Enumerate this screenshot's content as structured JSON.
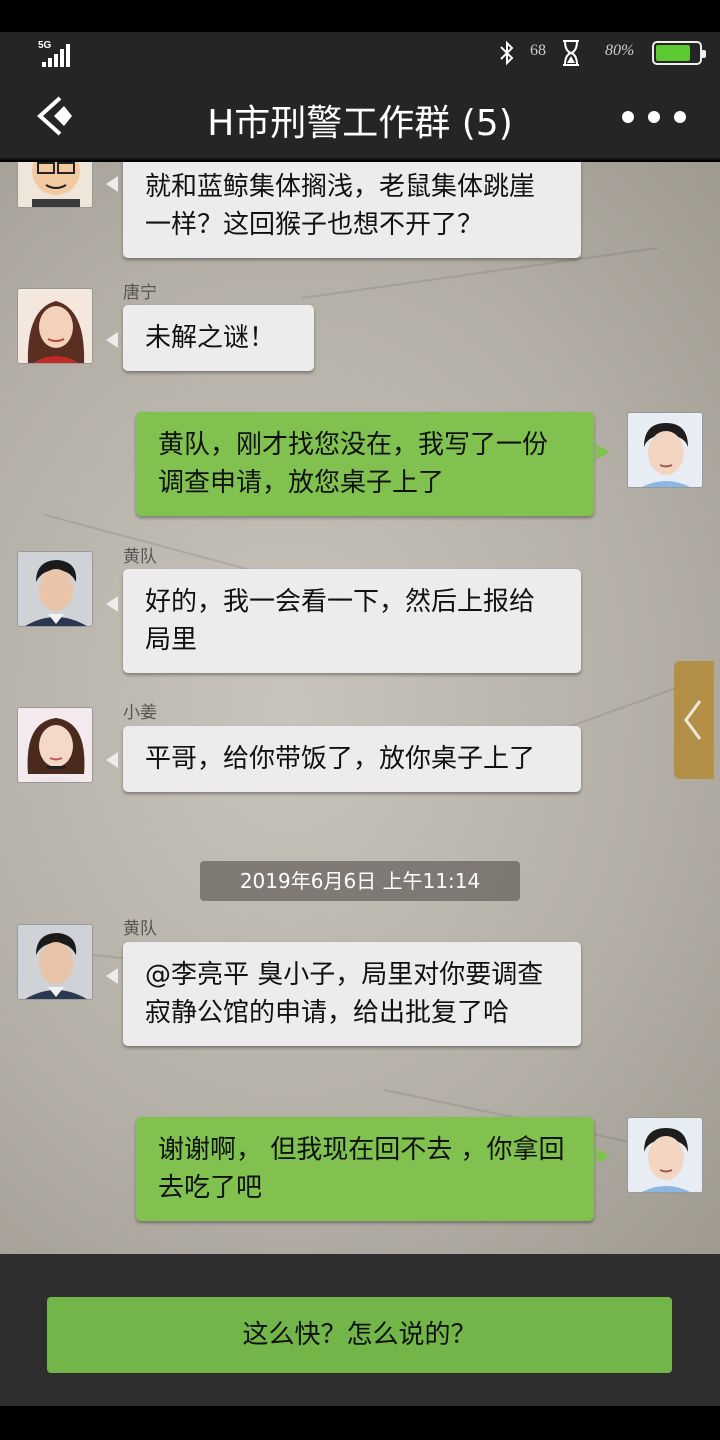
{
  "status_bar": {
    "network": "5G",
    "net_speed": "68",
    "battery_text": "80%",
    "battery_level": 0.8,
    "icons": [
      "signal-icon",
      "bluetooth-icon",
      "hourglass-icon",
      "battery-icon"
    ]
  },
  "header": {
    "title": "H市刑警工作群 (5)",
    "back_icon": "back-chevron-icon",
    "more_icon": "more-dots-icon"
  },
  "messages": [
    {
      "side": "left",
      "sender": "",
      "text": "就和蓝鲸集体搁浅，老鼠集体跳崖一样？这回猴子也想不开了？"
    },
    {
      "side": "left",
      "sender": "唐宁",
      "text": "未解之谜！"
    },
    {
      "side": "right",
      "sender": "",
      "text": "黄队，刚才找您没在，我写了一份调查申请，放您桌子上了"
    },
    {
      "side": "left",
      "sender": "黄队",
      "text": "好的，我一会看一下，然后上报给局里"
    },
    {
      "side": "left",
      "sender": "小姜",
      "text": "平哥，给你带饭了，放你桌子上了"
    },
    {
      "side": "left",
      "sender": "黄队",
      "text": "@李亮平  臭小子，局里对你要调查寂静公馆的申请，给出批复了哈"
    },
    {
      "side": "right",
      "sender": "",
      "text": "谢谢啊， 但我现在回不去 ，你拿回去吃了吧"
    }
  ],
  "timestamp": "2019年6月6日 上午11:14",
  "side_tab_icon": "chevron-left-icon",
  "reply_option": "这么快？怎么说的？",
  "colors": {
    "bubble_self": "#80c150",
    "bubble_other": "#ececec",
    "reply_button": "#72b64a",
    "header_bg": "#252525"
  }
}
